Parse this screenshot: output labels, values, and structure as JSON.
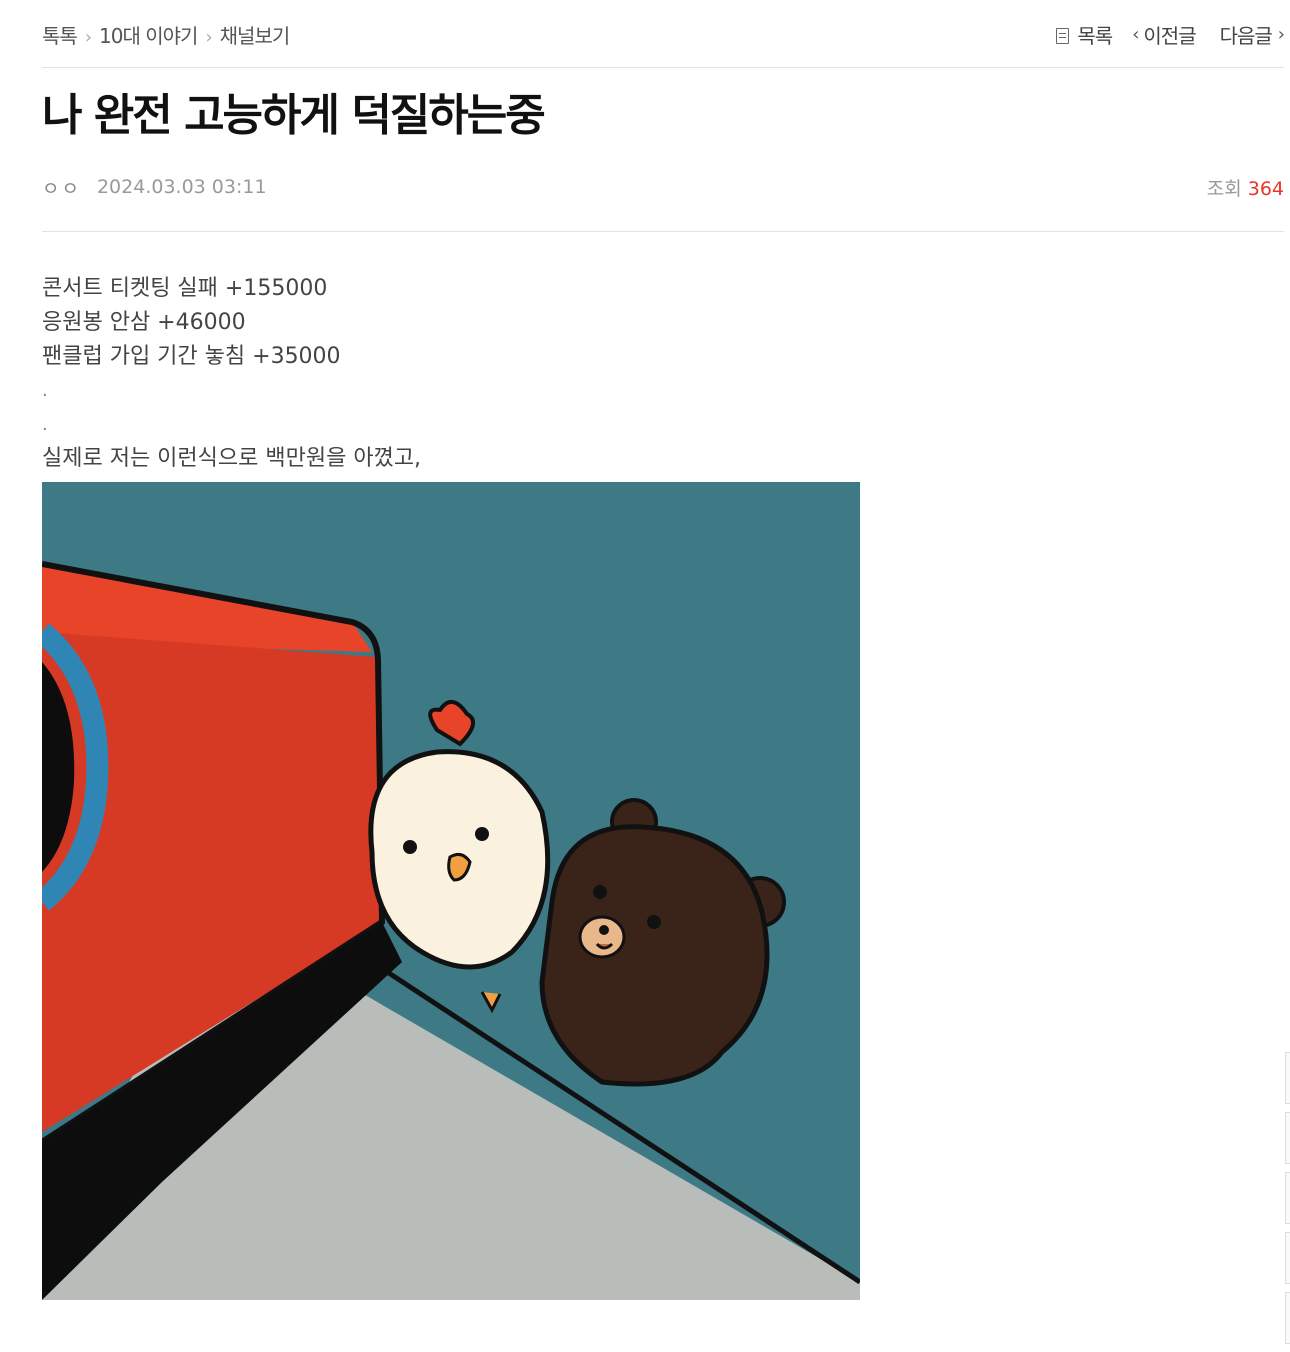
{
  "breadcrumb": [
    "톡톡",
    "10대 이야기",
    "채널보기"
  ],
  "nav": {
    "list": "목록",
    "prev": "이전글",
    "next": "다음글"
  },
  "post": {
    "title": "나 완전 고능하게 덕질하는중",
    "author": "ㅇㅇ",
    "date": "2024.03.03 03:11",
    "views_label": "조회",
    "views": "364"
  },
  "body_lines": [
    "콘서트 티켓팅 실패 +155000",
    "응원봉 안삼 +46000",
    "팬클럽 가입 기간 놓침 +35000",
    ".",
    ".",
    "실제로 저는 이런식으로 백만원을 아꼈고,"
  ],
  "colors": {
    "views": "#e8352a",
    "wall": "#3e7a86",
    "box": "#e8442a",
    "floor": "#b8bdba"
  },
  "image": {
    "subject": "cartoon chick and brown bear beside a red box"
  }
}
